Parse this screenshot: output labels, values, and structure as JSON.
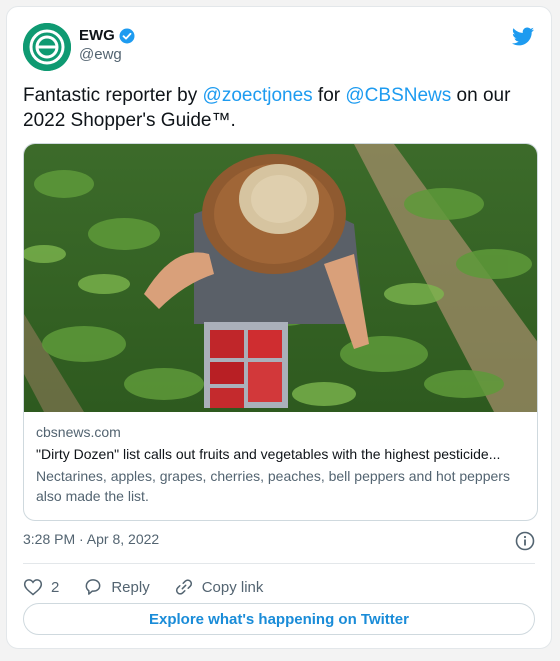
{
  "author": {
    "name": "EWG",
    "handle": "@ewg",
    "avatar_color": "#0f9a72",
    "verified_color": "#1d9bf0"
  },
  "tweet": {
    "text_before": "Fantastic reporter by ",
    "mention_1": "@zoectjones",
    "text_middle": " for ",
    "mention_2": "@CBSNews",
    "text_after": " on our 2022 Shopper's Guide™."
  },
  "link_card": {
    "domain": "cbsnews.com",
    "title": "\"Dirty Dozen\" list calls out fruits and vegetables with the highest pesticide...",
    "description": "Nectarines, apples, grapes, cherries, peaches, bell peppers and hot peppers also made the list.",
    "image_subject": "photo-farmer-picking-strawberries"
  },
  "meta": {
    "timestamp": "3:28 PM · Apr 8, 2022"
  },
  "actions": {
    "like_count": "2",
    "reply_label": "Reply",
    "copy_link_label": "Copy link"
  },
  "explore": {
    "label": "Explore what's happening on Twitter"
  },
  "icons": [
    "twitter-logo-icon",
    "verified-badge-icon",
    "info-icon",
    "heart-icon",
    "reply-icon",
    "link-icon"
  ]
}
